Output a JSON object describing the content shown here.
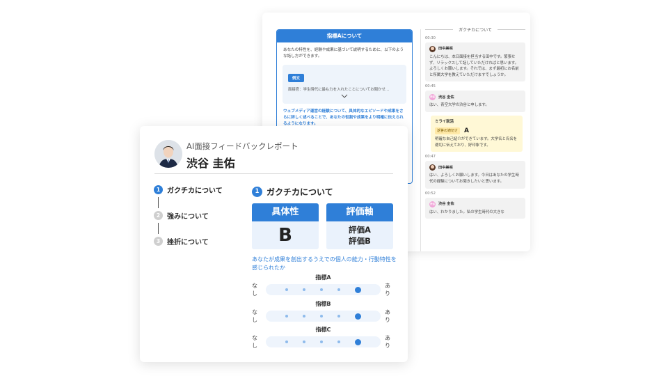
{
  "back_card": {
    "panel_title": "指標Aについて",
    "panel_desc": "あなたの特性を、経験や成果に基づいて説明するために、以下のような話し方ができます。",
    "example_tag": "例文",
    "example_text": "面接官：学生時代に最も力を入れたことについてお聞かせ…",
    "advice_text": "ウェブメディア運営の経験について、具体的なエピソードや成果をさらに詳しく述べることで、あなたの役割や成果をより明確に伝えられるようになります。",
    "chat_title": "ガクチカについて",
    "messages": [
      {
        "time": "00:30",
        "speaker": "田中美咲",
        "text": "こんにちは、本日面接を担当する田中です。緊張せず、リラックスして話していただければと思います。よろしくお願いします。それでは、まず最初にお名前と所属大学を教えていただけますでしょうか。"
      },
      {
        "time": "00:45",
        "speaker": "渋谷 圭佑",
        "text": "はい、青空大学の渋谷と申します。"
      },
      {
        "time": "00:47",
        "speaker": "田中美咲",
        "text": "はい、よろしくお願いします。今日はあなたの学生時代の経験についてお聞きしたいと思います。"
      },
      {
        "time": "00:52",
        "speaker": "渋谷 圭佑",
        "text": "はい、わかりました。私の学生時代の大きな"
      }
    ],
    "feedback": {
      "title": "ミライ就活",
      "badge": "返答の適切さ",
      "grade": "A",
      "text": "明確な自己紹介ができています。大学名と氏名を適切に伝えており、好印象です。"
    }
  },
  "front_card": {
    "report_title": "AI面接フィードバックレポート",
    "person_name": "渋谷 圭佑",
    "nav": [
      {
        "num": "1",
        "label": "ガクチカについて",
        "active": true
      },
      {
        "num": "2",
        "label": "強みについて",
        "active": false
      },
      {
        "num": "3",
        "label": "挫折について",
        "active": false
      }
    ],
    "section_num": "1",
    "section_title": "ガクチカについて",
    "score_specific_label": "具体性",
    "score_specific_value": "B",
    "score_axis_label": "評価軸",
    "score_axis_line1": "評価A",
    "score_axis_line2": "評価B",
    "description": "あなたが成果を創出するうえでの個人の能力・行動特性を感じられたか",
    "scales": [
      {
        "name": "指標A",
        "left": "なし",
        "right": "あり",
        "selected": 5,
        "steps": 5
      },
      {
        "name": "指標B",
        "left": "なし",
        "right": "あり",
        "selected": 5,
        "steps": 5
      },
      {
        "name": "指標C",
        "left": "なし",
        "right": "あり",
        "selected": 5,
        "steps": 5
      }
    ]
  },
  "colors": {
    "accent": "#2f7fd8",
    "feedback_bg": "#fff8d6",
    "bubble_bg": "#f2f2f2"
  },
  "icons": [
    "chevron-down-icon",
    "avatar-icon"
  ]
}
